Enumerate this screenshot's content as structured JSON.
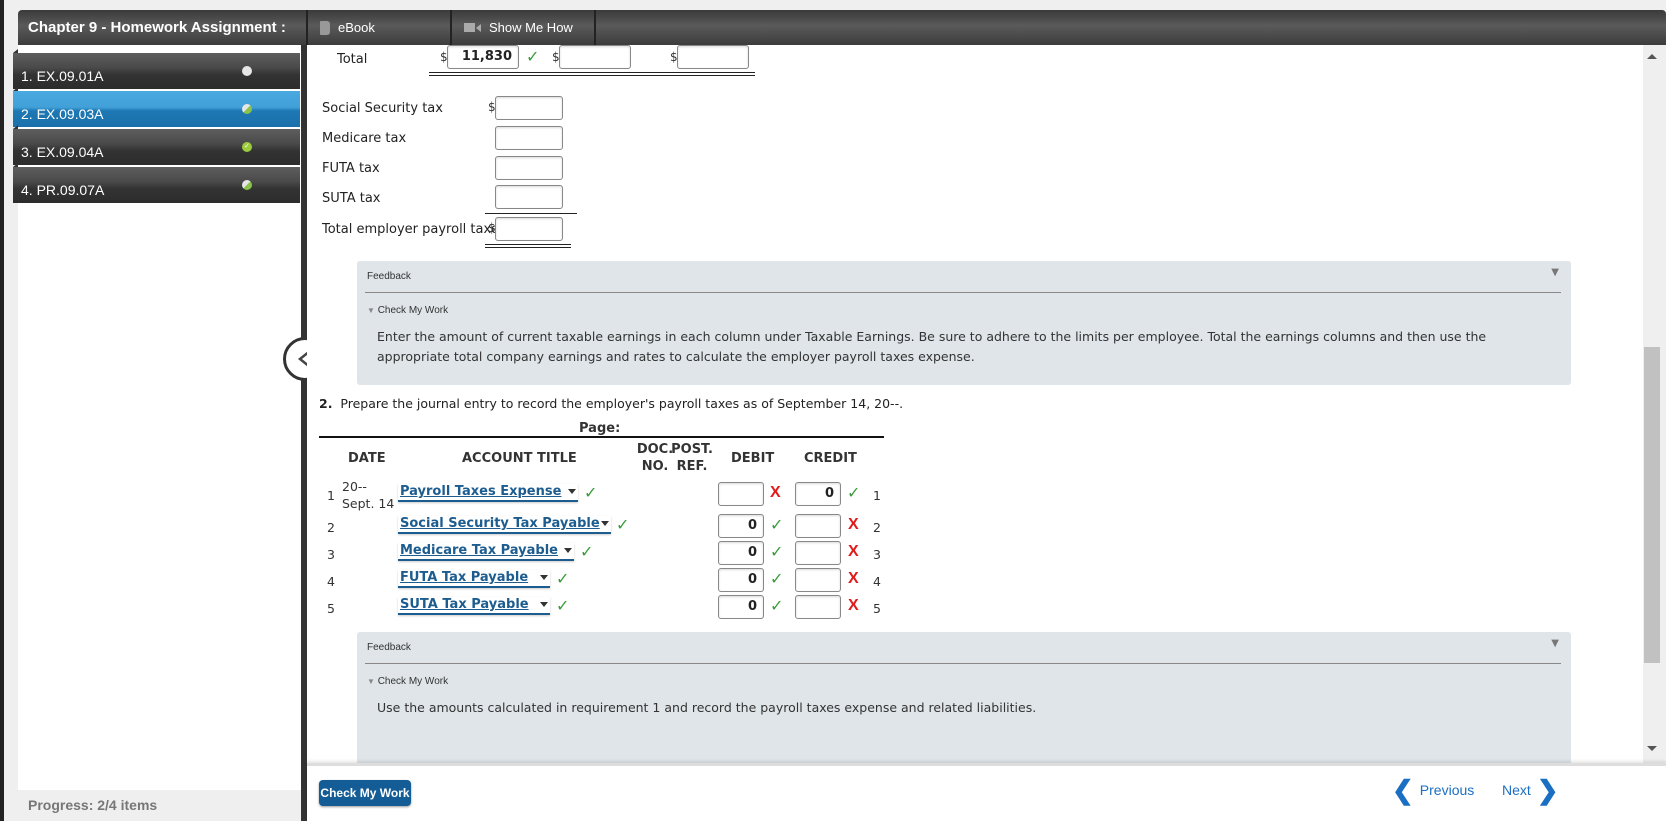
{
  "header": {
    "title": "Chapter 9 - Homework Assignment :",
    "tabs": [
      {
        "label": "eBook",
        "icon": "book-icon"
      },
      {
        "label": "Show Me How",
        "icon": "video-icon"
      }
    ]
  },
  "sidebar": {
    "items": [
      {
        "label": "1. EX.09.01A",
        "status": "not-started"
      },
      {
        "label": "2. EX.09.03A",
        "status": "partial",
        "active": true
      },
      {
        "label": "3. EX.09.04A",
        "status": "complete"
      },
      {
        "label": "4. PR.09.07A",
        "status": "partial"
      }
    ],
    "progress_label": "Progress:",
    "progress_value": "2/4 items"
  },
  "part1": {
    "total_label": "Total",
    "total_values": [
      "11,830",
      "",
      ""
    ],
    "total_currency": "$",
    "taxes": [
      {
        "label": "Social Security tax",
        "value": "",
        "currency": "$"
      },
      {
        "label": "Medicare tax",
        "value": "",
        "currency": ""
      },
      {
        "label": "FUTA tax",
        "value": "",
        "currency": ""
      },
      {
        "label": "SUTA tax",
        "value": "",
        "currency": ""
      },
      {
        "label": "Total employer payroll taxes",
        "value": "",
        "currency": "$"
      }
    ],
    "feedback": {
      "title": "Feedback",
      "subtitle": "Check My Work",
      "text": "Enter the amount of current taxable earnings in each column under Taxable Earnings. Be sure to adhere to the limits per employee. Total the earnings columns and then use the appropriate total company earnings and rates to calculate the employer payroll taxes expense."
    }
  },
  "part2": {
    "number": "2.",
    "prompt": "Prepare the journal entry to record the employer's payroll taxes as of September 14, 20--.",
    "page_label": "Page:",
    "columns": {
      "date": "DATE",
      "account": "ACCOUNT TITLE",
      "doc": "DOC. NO.",
      "doc1": "DOC.",
      "doc2": "NO.",
      "post1": "POST.",
      "post2": "REF.",
      "debit": "DEBIT",
      "credit": "CREDIT"
    },
    "date_year": "20--",
    "date_day": "Sept. 14",
    "rows": [
      {
        "num": "1",
        "account": "Payroll Taxes Expense",
        "account_ok": true,
        "debit": "",
        "debit_status": "wrong",
        "credit": "0",
        "credit_status": "correct"
      },
      {
        "num": "2",
        "account": "Social Security Tax Payable",
        "account_ok": true,
        "debit": "0",
        "debit_status": "correct",
        "credit": "",
        "credit_status": "wrong"
      },
      {
        "num": "3",
        "account": "Medicare Tax Payable",
        "account_ok": true,
        "debit": "0",
        "debit_status": "correct",
        "credit": "",
        "credit_status": "wrong"
      },
      {
        "num": "4",
        "account": "FUTA Tax Payable",
        "account_ok": true,
        "debit": "0",
        "debit_status": "correct",
        "credit": "",
        "credit_status": "wrong"
      },
      {
        "num": "5",
        "account": "SUTA Tax Payable",
        "account_ok": true,
        "debit": "0",
        "debit_status": "correct",
        "credit": "",
        "credit_status": "wrong"
      }
    ],
    "feedback": {
      "title": "Feedback",
      "subtitle": "Check My Work",
      "text": "Use the amounts calculated in requirement 1 and record the payroll taxes expense and related liabilities."
    }
  },
  "footer": {
    "check_button": "Check My Work",
    "previous": "Previous",
    "next": "Next"
  },
  "symbols": {
    "check": "✓",
    "x": "X",
    "caret": "▼"
  },
  "colors": {
    "accent": "#135c96",
    "correct": "#3a9c3a",
    "wrong": "#e01b1b",
    "active_item": "#2a8ccc",
    "link": "#1b6fc2"
  }
}
